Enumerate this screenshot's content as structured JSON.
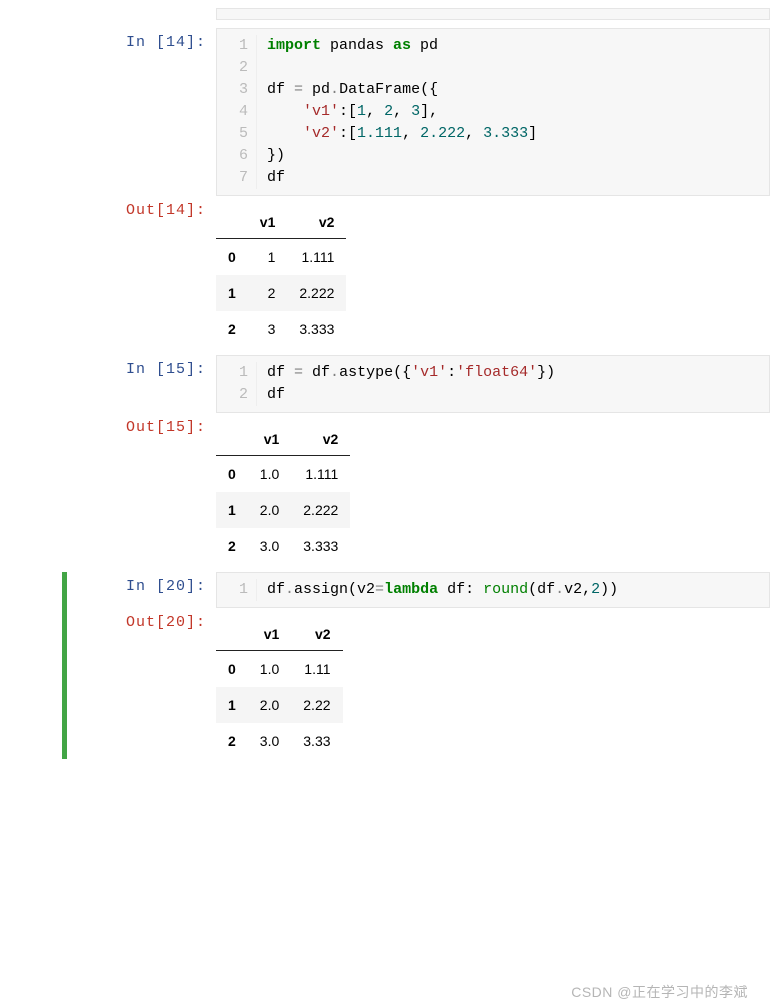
{
  "cells": [
    {
      "in_prompt": "In  [14]:",
      "out_prompt": "Out[14]:",
      "line_numbers": [
        "1",
        "2",
        "3",
        "4",
        "5",
        "6",
        "7"
      ],
      "code_tokens": [
        [
          {
            "t": "import",
            "c": "kw-import"
          },
          {
            "t": " pandas ",
            "c": ""
          },
          {
            "t": "as",
            "c": "kw-as"
          },
          {
            "t": " pd",
            "c": ""
          }
        ],
        [],
        [
          {
            "t": "df ",
            "c": ""
          },
          {
            "t": "=",
            "c": "op"
          },
          {
            "t": " pd",
            "c": ""
          },
          {
            "t": ".",
            "c": "op"
          },
          {
            "t": "DataFrame({",
            "c": ""
          }
        ],
        [
          {
            "t": "    ",
            "c": ""
          },
          {
            "t": "'v1'",
            "c": "str"
          },
          {
            "t": ":[",
            "c": ""
          },
          {
            "t": "1",
            "c": "num"
          },
          {
            "t": ", ",
            "c": ""
          },
          {
            "t": "2",
            "c": "num"
          },
          {
            "t": ", ",
            "c": ""
          },
          {
            "t": "3",
            "c": "num"
          },
          {
            "t": "],",
            "c": ""
          }
        ],
        [
          {
            "t": "    ",
            "c": ""
          },
          {
            "t": "'v2'",
            "c": "str"
          },
          {
            "t": ":[",
            "c": ""
          },
          {
            "t": "1.111",
            "c": "num"
          },
          {
            "t": ", ",
            "c": ""
          },
          {
            "t": "2.222",
            "c": "num"
          },
          {
            "t": ", ",
            "c": ""
          },
          {
            "t": "3.333",
            "c": "num"
          },
          {
            "t": "]",
            "c": ""
          }
        ],
        [
          {
            "t": "})",
            "c": ""
          }
        ],
        [
          {
            "t": "df",
            "c": ""
          }
        ]
      ],
      "table": {
        "columns": [
          "v1",
          "v2"
        ],
        "index": [
          "0",
          "1",
          "2"
        ],
        "rows": [
          [
            "1",
            "1.111"
          ],
          [
            "2",
            "2.222"
          ],
          [
            "3",
            "3.333"
          ]
        ]
      }
    },
    {
      "in_prompt": "In  [15]:",
      "out_prompt": "Out[15]:",
      "line_numbers": [
        "1",
        "2"
      ],
      "code_tokens": [
        [
          {
            "t": "df ",
            "c": ""
          },
          {
            "t": "=",
            "c": "op"
          },
          {
            "t": " df",
            "c": ""
          },
          {
            "t": ".",
            "c": "op"
          },
          {
            "t": "astype({",
            "c": ""
          },
          {
            "t": "'v1'",
            "c": "str"
          },
          {
            "t": ":",
            "c": ""
          },
          {
            "t": "'float64'",
            "c": "str"
          },
          {
            "t": "})",
            "c": ""
          }
        ],
        [
          {
            "t": "df",
            "c": ""
          }
        ]
      ],
      "table": {
        "columns": [
          "v1",
          "v2"
        ],
        "index": [
          "0",
          "1",
          "2"
        ],
        "rows": [
          [
            "1.0",
            "1.111"
          ],
          [
            "2.0",
            "2.222"
          ],
          [
            "3.0",
            "3.333"
          ]
        ]
      }
    },
    {
      "selected": true,
      "in_prompt": "In  [20]:",
      "out_prompt": "Out[20]:",
      "line_numbers": [
        "1"
      ],
      "code_tokens": [
        [
          {
            "t": "df",
            "c": ""
          },
          {
            "t": ".",
            "c": "op"
          },
          {
            "t": "assign(v2",
            "c": ""
          },
          {
            "t": "=",
            "c": "op"
          },
          {
            "t": "lambda",
            "c": "kw-lambda"
          },
          {
            "t": " df: ",
            "c": ""
          },
          {
            "t": "round",
            "c": "fn"
          },
          {
            "t": "(df",
            "c": ""
          },
          {
            "t": ".",
            "c": "op"
          },
          {
            "t": "v2,",
            "c": ""
          },
          {
            "t": "2",
            "c": "num"
          },
          {
            "t": "))",
            "c": ""
          }
        ]
      ],
      "table": {
        "columns": [
          "v1",
          "v2"
        ],
        "index": [
          "0",
          "1",
          "2"
        ],
        "rows": [
          [
            "1.0",
            "1.11"
          ],
          [
            "2.0",
            "2.22"
          ],
          [
            "3.0",
            "3.33"
          ]
        ]
      }
    }
  ],
  "watermark": "CSDN @正在学习中的李斌"
}
